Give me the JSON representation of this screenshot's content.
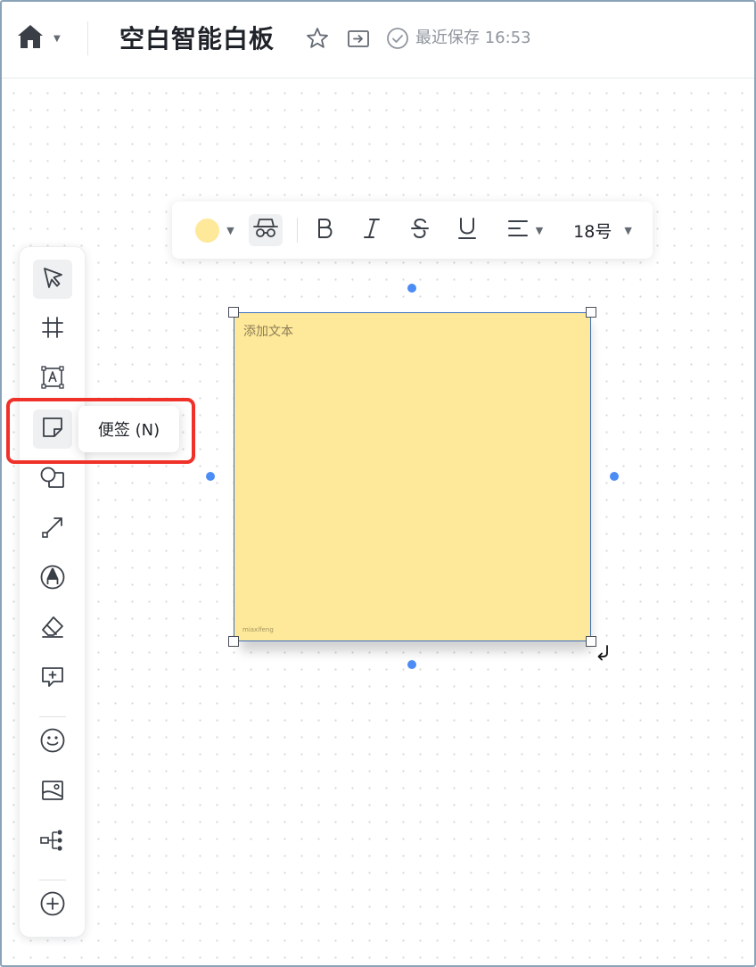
{
  "header": {
    "title": "空白智能白板",
    "save_status": "最近保存 16:53",
    "icons": [
      "home-icon",
      "chevron-down-icon",
      "star-icon",
      "move-to-folder-icon",
      "check-circle-icon"
    ]
  },
  "toolbar": {
    "tools": [
      {
        "name": "select",
        "icon": "cursor-arrow-icon",
        "active": true
      },
      {
        "name": "frame",
        "icon": "frame-grid-icon"
      },
      {
        "name": "text",
        "icon": "text-box-icon"
      },
      {
        "name": "sticky-note",
        "icon": "sticky-note-icon",
        "hovered": true
      },
      {
        "name": "shape",
        "icon": "shape-icon"
      },
      {
        "name": "connector",
        "icon": "connector-arrow-icon"
      },
      {
        "name": "pen",
        "icon": "pen-icon"
      },
      {
        "name": "eraser",
        "icon": "eraser-icon"
      },
      {
        "name": "comment",
        "icon": "comment-add-icon"
      },
      {
        "name": "emoji",
        "icon": "emoji-icon"
      },
      {
        "name": "image",
        "icon": "image-icon"
      },
      {
        "name": "mindmap",
        "icon": "mindmap-icon"
      },
      {
        "name": "more",
        "icon": "plus-circle-icon"
      }
    ]
  },
  "tooltip": {
    "text": "便签 (N)"
  },
  "format_bar": {
    "fill_color": "#fee899",
    "font_size": "18号",
    "items": [
      "color-swatch",
      "anonymous-icon",
      "bold-icon",
      "italic-icon",
      "strikethrough-icon",
      "underline-icon",
      "align-left-icon",
      "font-size"
    ]
  },
  "sticky_note": {
    "placeholder": "添加文本",
    "author": "miaxlfeng",
    "color": "#fee899"
  },
  "colors": {
    "accent": "#4c8cf5",
    "selection": "#3c6ec2",
    "highlight": "#f0312a"
  }
}
